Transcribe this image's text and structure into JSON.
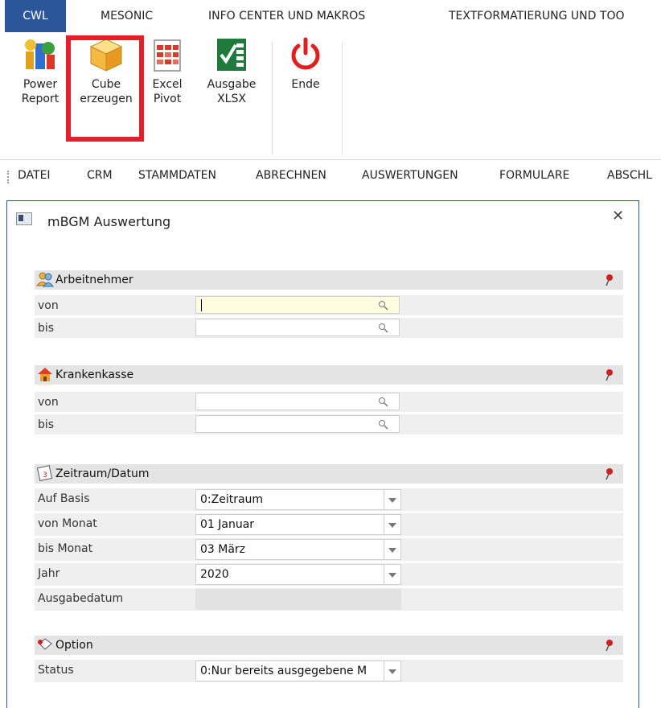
{
  "tabs": [
    {
      "label": "CWL",
      "active": true
    },
    {
      "label": "MESONIC",
      "active": false
    },
    {
      "label": "INFO CENTER UND MAKROS",
      "active": false
    },
    {
      "label": "TEXTFORMATIERUNG UND TOO",
      "active": false
    }
  ],
  "ribbon": {
    "power_report": {
      "line1": "Power",
      "line2": "Report"
    },
    "cube": {
      "line1": "Cube",
      "line2": "erzeugen"
    },
    "excel_pivot": {
      "line1": "Excel",
      "line2": "Pivot"
    },
    "ausgabe_xlsx": {
      "line1": "Ausgabe",
      "line2": "XLSX"
    },
    "ende": {
      "line1": "Ende"
    }
  },
  "menubar": [
    "DATEI",
    "CRM",
    "STAMMDATEN",
    "ABRECHNEN",
    "AUSWERTUNGEN",
    "FORMULARE",
    "ABSCHL"
  ],
  "window": {
    "title": "mBGM Auswertung",
    "close": "✕",
    "sections": {
      "arbeitnehmer": {
        "title": "Arbeitnehmer",
        "von_label": "von",
        "bis_label": "bis",
        "von_value": "",
        "bis_value": ""
      },
      "krankenkasse": {
        "title": "Krankenkasse",
        "von_label": "von",
        "bis_label": "bis",
        "von_value": "",
        "bis_value": ""
      },
      "zeitraum": {
        "title": "Zeitraum/Datum",
        "auf_basis_label": "Auf Basis",
        "auf_basis_value": "0:Zeitraum",
        "von_monat_label": "von Monat",
        "von_monat_value": "01 Januar",
        "bis_monat_label": "bis Monat",
        "bis_monat_value": "03 März",
        "jahr_label": "Jahr",
        "jahr_value": "2020",
        "ausgabedatum_label": "Ausgabedatum",
        "ausgabedatum_value": ""
      },
      "option": {
        "title": "Option",
        "status_label": "Status",
        "status_value": "0:Nur bereits ausgegebene M"
      }
    }
  },
  "colors": {
    "accent": "#2b579a",
    "highlight": "#e81d2a"
  }
}
